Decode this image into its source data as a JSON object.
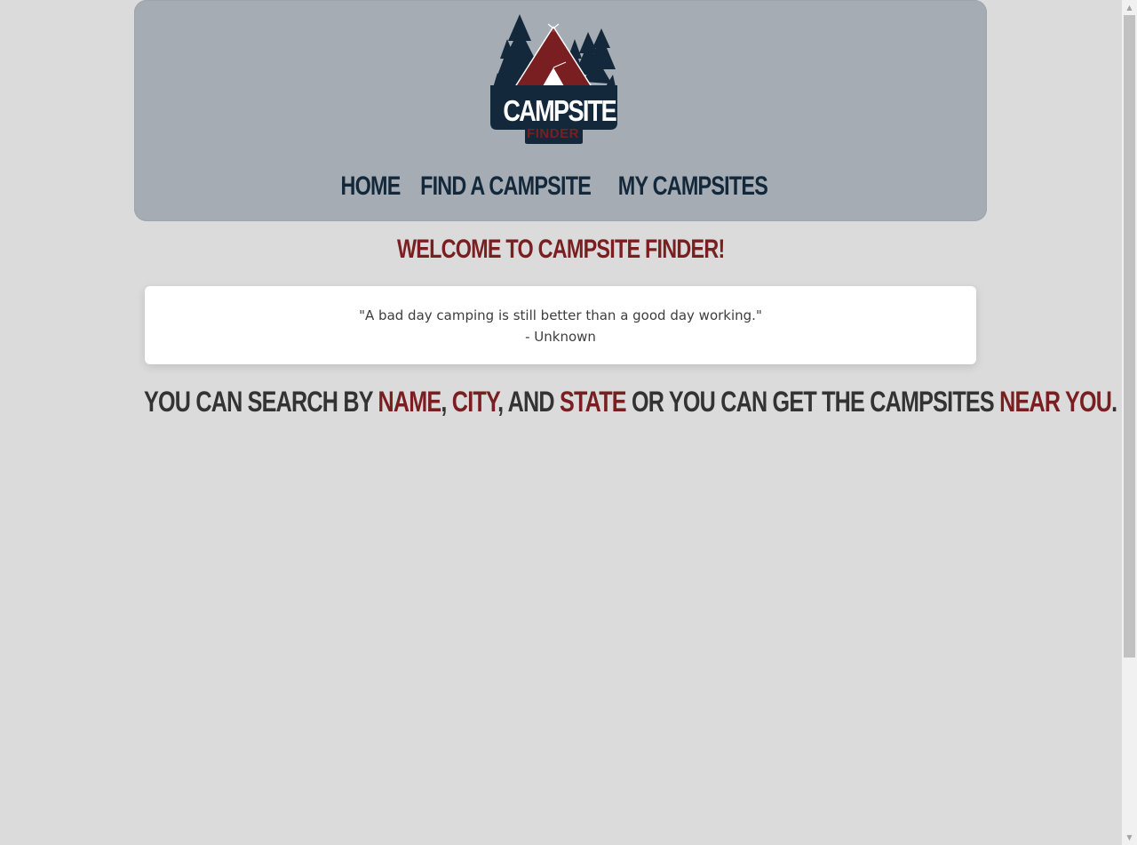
{
  "header": {
    "logo": {
      "title": "CAMPSITE",
      "subtitle": "FINDER"
    },
    "nav": [
      {
        "label": "HOME"
      },
      {
        "label": "FIND A CAMPSITE"
      },
      {
        "label": "MY CAMPSITES"
      }
    ]
  },
  "main": {
    "welcome_heading": "WELCOME TO CAMPSITE FINDER!",
    "quote": {
      "text": "\"A bad day camping is still better than a good day working.\"",
      "author": "- Unknown"
    },
    "search_hint": {
      "part1": "YOU CAN SEARCH BY ",
      "name": "NAME",
      "sep1": ", ",
      "city": "CITY",
      "sep2": ", AND ",
      "state": "STATE",
      "part2": " OR YOU CAN GET THE CAMPSITES ",
      "near_you": "NEAR YOU",
      "end": "."
    }
  },
  "colors": {
    "page_background": "#dbdbdb",
    "header_background": "#a6acb3",
    "navy": "#14283b",
    "maroon": "#7a1f21",
    "text_dark": "#333333"
  },
  "icons": {
    "logo": "tent-and-pine-trees-logo",
    "scroll_up": "triangle-up-icon",
    "scroll_down": "triangle-down-icon"
  }
}
